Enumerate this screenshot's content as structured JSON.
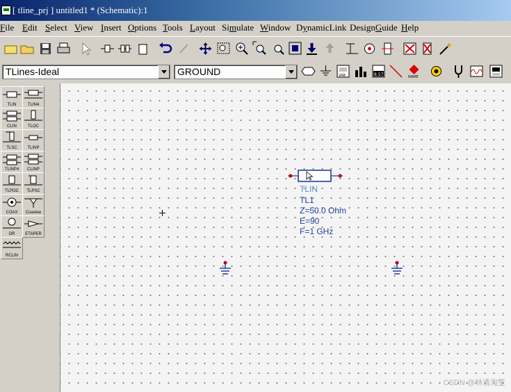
{
  "window": {
    "title": "[ tline_prj ] untitled1 * (Schematic):1"
  },
  "menu": [
    {
      "pre": "",
      "u": "F",
      "post": "ile"
    },
    {
      "pre": "",
      "u": "E",
      "post": "dit"
    },
    {
      "pre": "",
      "u": "S",
      "post": "elect"
    },
    {
      "pre": "",
      "u": "V",
      "post": "iew"
    },
    {
      "pre": "",
      "u": "I",
      "post": "nsert"
    },
    {
      "pre": "",
      "u": "O",
      "post": "ptions"
    },
    {
      "pre": "",
      "u": "T",
      "post": "ools"
    },
    {
      "pre": "",
      "u": "L",
      "post": "ayout"
    },
    {
      "pre": "Si",
      "u": "m",
      "post": "ulate"
    },
    {
      "pre": "",
      "u": "W",
      "post": "indow"
    },
    {
      "pre": "D",
      "u": "y",
      "post": "namicLink"
    },
    {
      "pre": "Design",
      "u": "G",
      "post": "uide"
    },
    {
      "pre": "",
      "u": "H",
      "post": "elp"
    }
  ],
  "toolbar": {
    "library_select": "TLines-Ideal",
    "component_select": "GROUND"
  },
  "palette": [
    "TLIN",
    "TLIN4",
    "CLIN",
    "TLOC",
    "TLSC",
    "TLINP",
    "TLINP4",
    "CLINP",
    "TLPOC",
    "TLPSC",
    "COAX",
    "Coaxtee",
    "DR",
    "ETAPER",
    "RCLIN"
  ],
  "component": {
    "type": "TLIN",
    "name": "TL1",
    "z": "Z=50.0 Ohm",
    "e": "E=90",
    "f": "F=1 GHz"
  },
  "watermark": "CSDN @林清淘笙",
  "colors": {
    "wire_end": "#d00000",
    "component_body": "#1f3f9f",
    "title_gradient_start": "#0a246a"
  }
}
